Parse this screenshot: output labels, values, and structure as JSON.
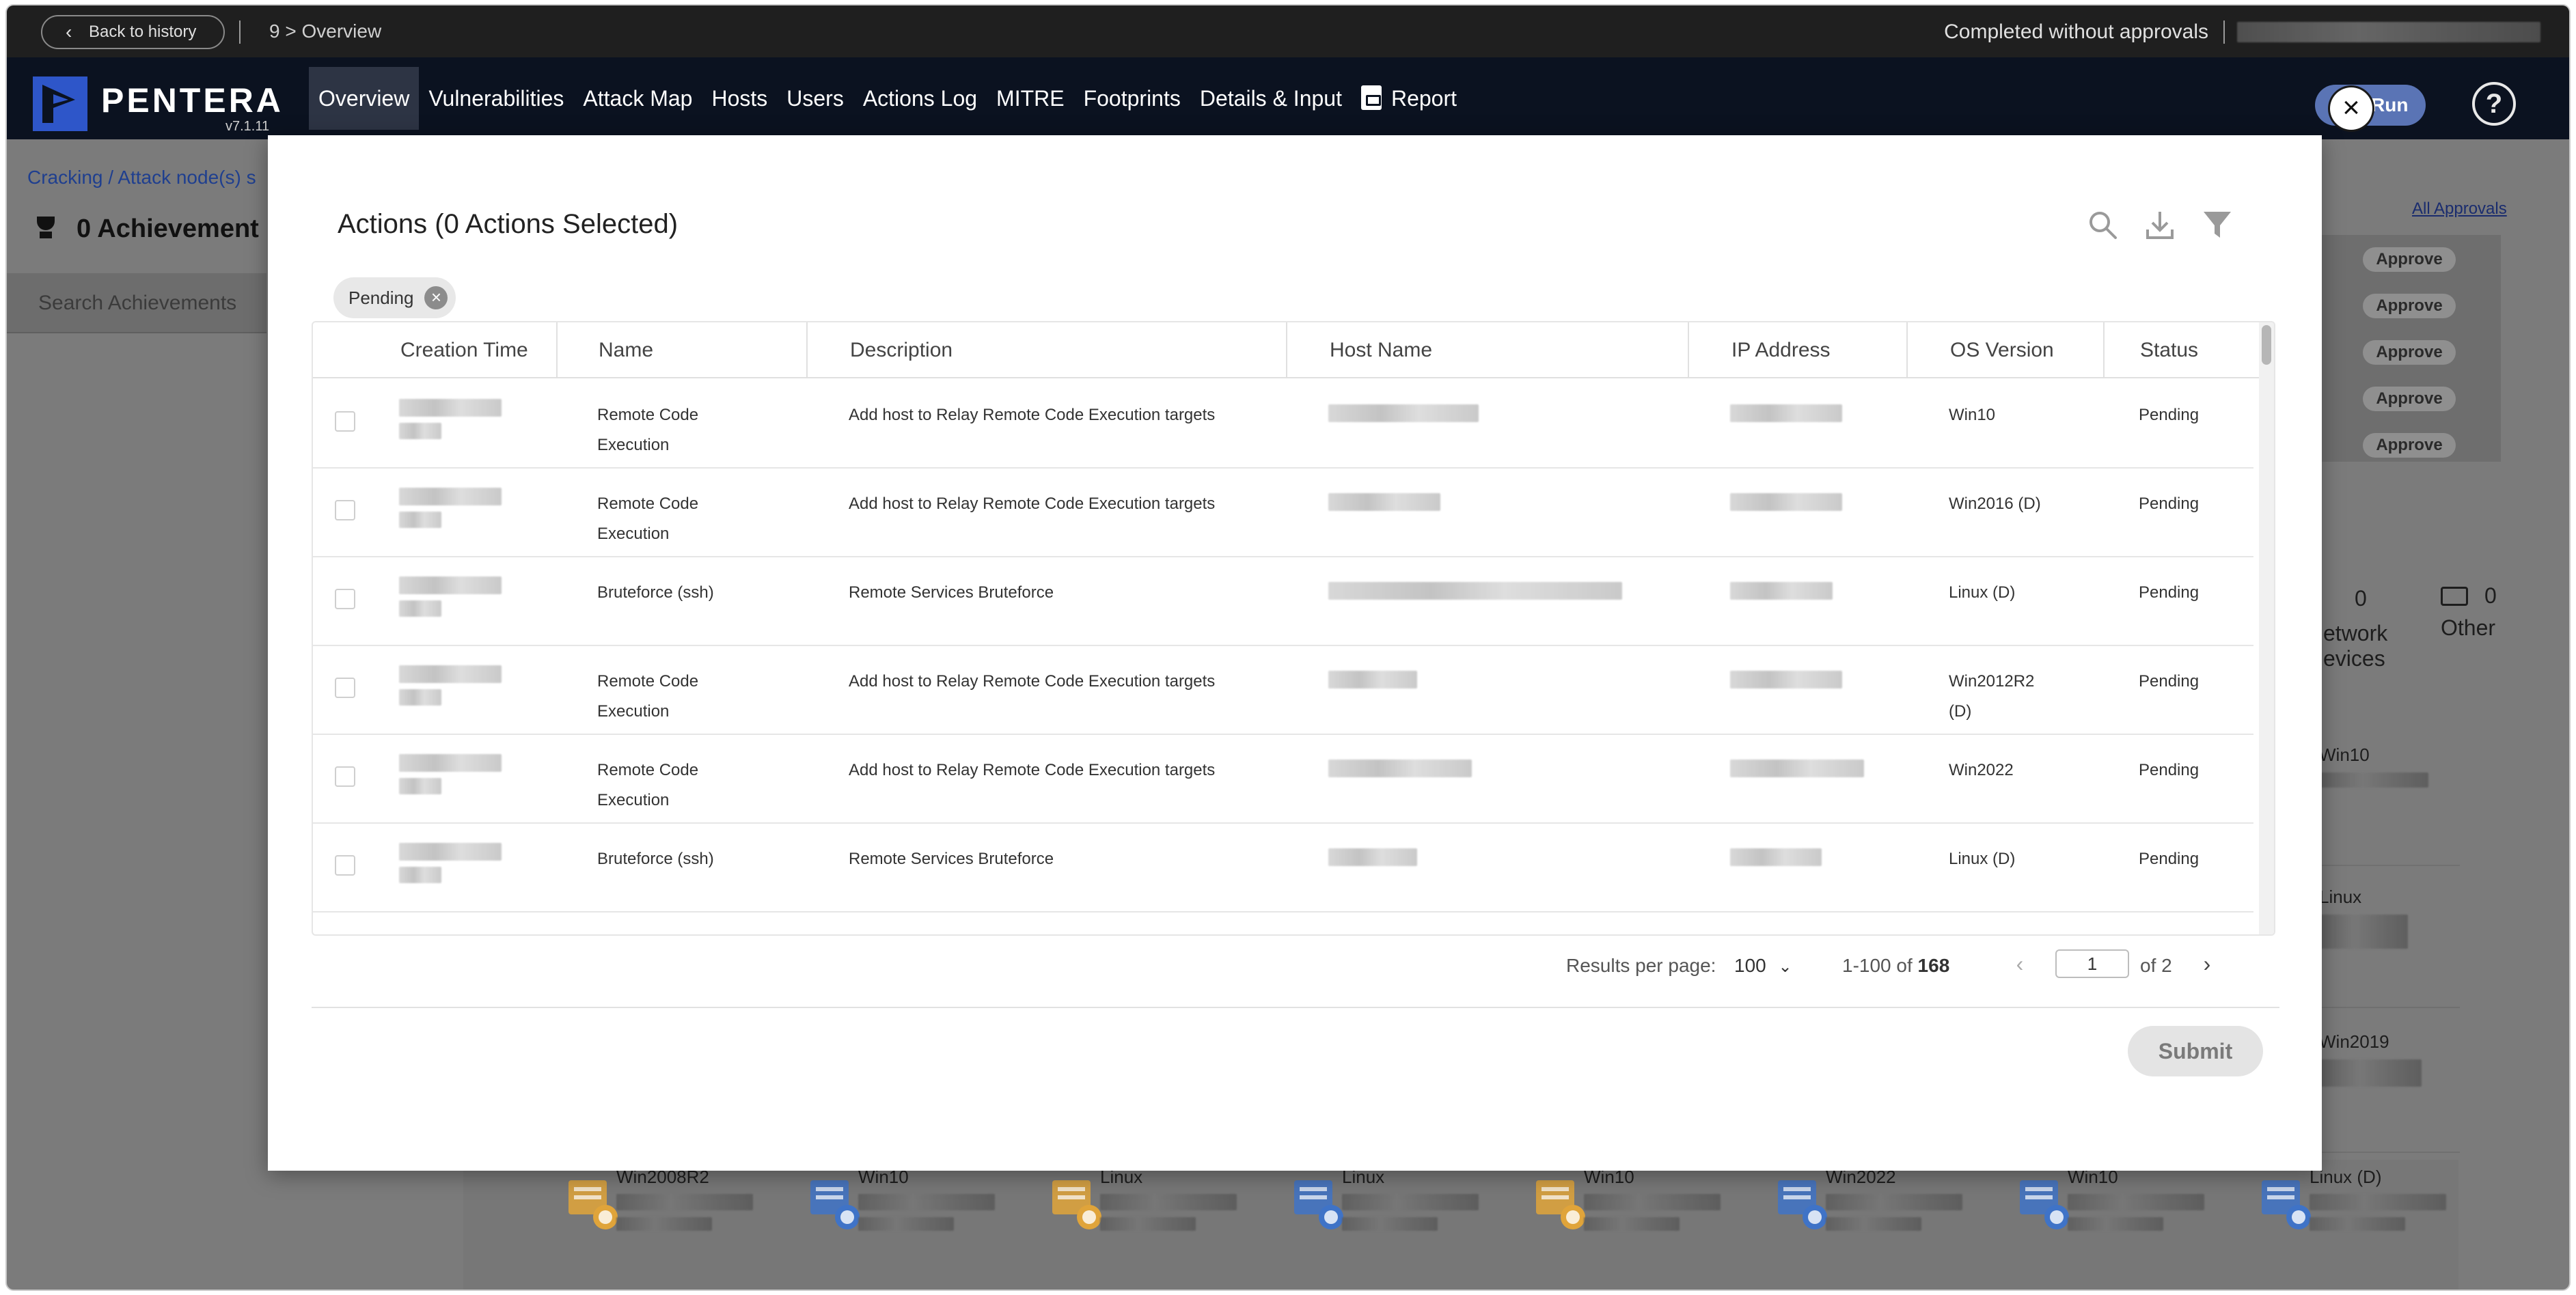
{
  "topbar": {
    "back_label": "Back to history",
    "breadcrumb": "9 > Overview",
    "status": "Completed without approvals"
  },
  "navbar": {
    "brand": "PENTERA",
    "version": "v7.1.11",
    "items": [
      "Overview",
      "Vulnerabilities",
      "Attack Map",
      "Hosts",
      "Users",
      "Actions Log",
      "MITRE",
      "Footprints",
      "Details & Input",
      "Report"
    ],
    "active": "Overview",
    "run_label": "Run",
    "help_glyph": "?"
  },
  "background": {
    "breadcrumb": "Cracking / Attack node(s) s",
    "achievements": "0 Achievement",
    "search_placeholder": "Search Achievements",
    "all_approvals": "All Approvals",
    "approve_label": "Approve",
    "stats": [
      {
        "count": "0",
        "label1": "etwork",
        "label2": "evices"
      },
      {
        "count": "0",
        "label1": "Other",
        "label2": ""
      }
    ],
    "side_os": [
      "Win10",
      "Linux",
      "Win2019"
    ],
    "host_tiles": [
      "Win2008R2",
      "Win10",
      "Linux",
      "Linux",
      "Win10",
      "Win2022",
      "Win10",
      "Linux (D)"
    ]
  },
  "modal": {
    "title": "Actions (0 Actions Selected)",
    "filter_chip": "Pending",
    "columns": [
      "Creation Time",
      "Name",
      "Description",
      "Host Name",
      "IP Address",
      "OS Version",
      "Status"
    ],
    "rows": [
      {
        "name": [
          "Remote Code",
          "Execution"
        ],
        "description": "Add host to Relay Remote Code Execution targets",
        "os": [
          "Win10"
        ],
        "status": "Pending"
      },
      {
        "name": [
          "Remote Code",
          "Execution"
        ],
        "description": "Add host to Relay Remote Code Execution targets",
        "os": [
          "Win2016 (D)"
        ],
        "status": "Pending"
      },
      {
        "name": [
          "Bruteforce (ssh)"
        ],
        "description": "Remote Services Bruteforce",
        "os": [
          "Linux (D)"
        ],
        "status": "Pending"
      },
      {
        "name": [
          "Remote Code",
          "Execution"
        ],
        "description": "Add host to Relay Remote Code Execution targets",
        "os": [
          "Win2012R2",
          "(D)"
        ],
        "status": "Pending"
      },
      {
        "name": [
          "Remote Code",
          "Execution"
        ],
        "description": "Add host to Relay Remote Code Execution targets",
        "os": [
          "Win2022"
        ],
        "status": "Pending"
      },
      {
        "name": [
          "Bruteforce (ssh)"
        ],
        "description": "Remote Services Bruteforce",
        "os": [
          "Linux (D)"
        ],
        "status": "Pending"
      }
    ],
    "pagination": {
      "results_label": "Results per page:",
      "per_page": "100",
      "range": "1-100",
      "of_word": "of",
      "total": "168",
      "page": "1",
      "of_pages": "of 2"
    },
    "submit_label": "Submit"
  },
  "colors": {
    "nav_bg": "#0b1220",
    "brand_blue": "#2e56c9",
    "run_button": "#5a74b5",
    "overlay": "#7b7b7b"
  },
  "icons": [
    "back-chevron-icon",
    "pentera-logo-icon",
    "report-pdf-icon",
    "help-icon",
    "close-icon",
    "search-icon",
    "download-icon",
    "filter-icon",
    "chip-remove-icon",
    "trophy-icon",
    "chevron-left-icon",
    "chevron-right-icon",
    "chevron-down-icon"
  ]
}
